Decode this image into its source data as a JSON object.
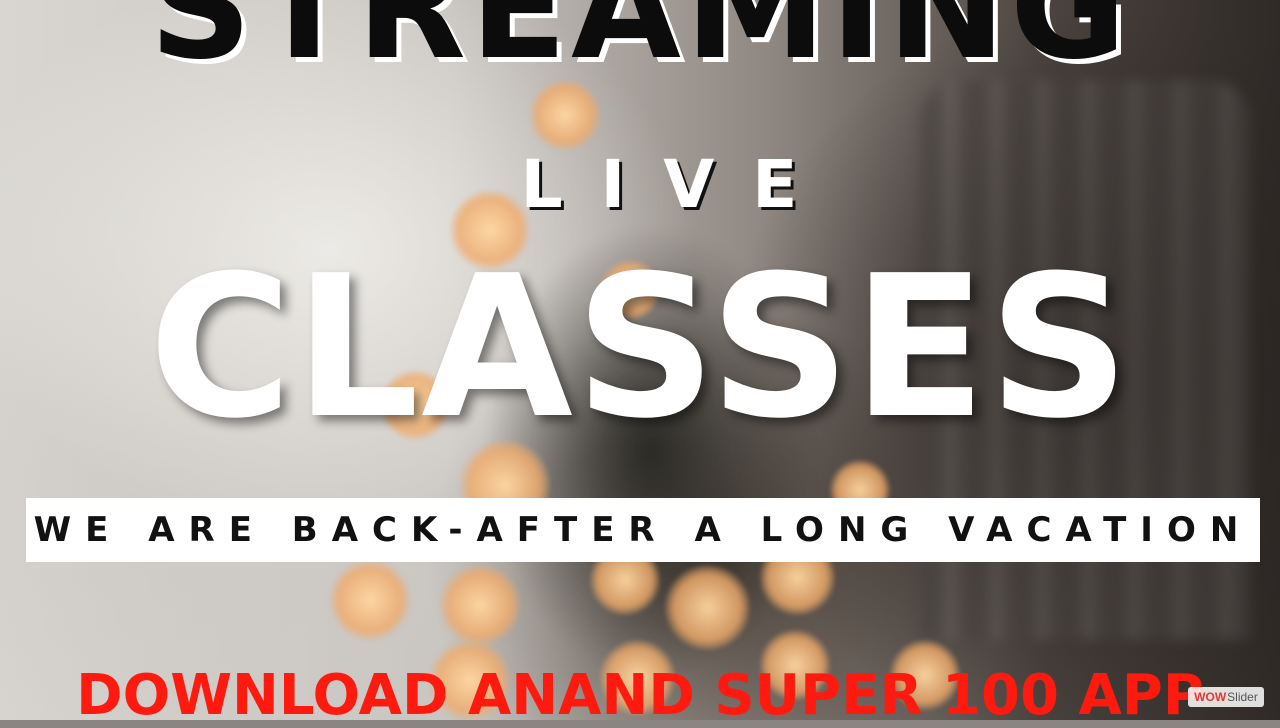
{
  "poster": {
    "headline_top": "STREAMING",
    "headline_middle": "LIVE",
    "headline_main": "CLASSES",
    "banner_text": "WE ARE BACK-AFTER A LONG VACATION",
    "cta_text": "DOWNLOAD ANAND SUPER 100 APP"
  },
  "watermark": {
    "brand_part1": "WOW",
    "brand_part2": "Slider"
  },
  "colors": {
    "cta": "#ff1a10",
    "headline_dark": "#0c0c0c",
    "headline_light": "#ffffff",
    "banner_bg": "#ffffff"
  }
}
